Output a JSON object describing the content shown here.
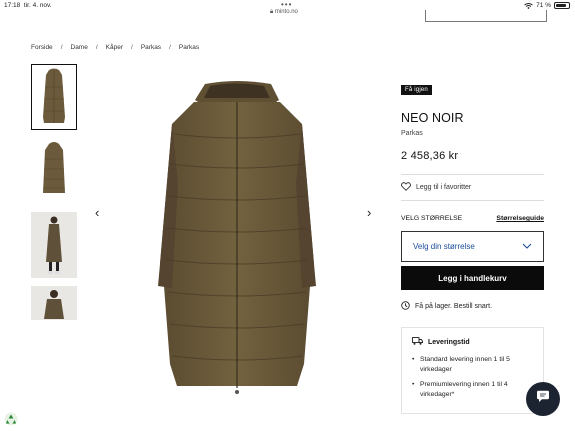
{
  "status_bar": {
    "time": "17:18",
    "date": "tir. 4. nov.",
    "url": "minto.no",
    "battery": "71 %",
    "battery_level": 0.71
  },
  "breadcrumb": [
    "Forside",
    "Dame",
    "Kåper",
    "Parkas",
    "Parkas"
  ],
  "product": {
    "badge": "Få igjen",
    "brand": "NEO NOIR",
    "category": "Parkas",
    "price": "2 458,36 kr",
    "favorite_label": "Legg til i favoritter",
    "size_label": "VELG STØRRELSE",
    "size_guide": "Størrelseguide",
    "size_select": "Velg din størrelse",
    "cart_button": "Legg i handlekurv",
    "stock_text": "Få på lager. Bestill snart."
  },
  "delivery": {
    "title": "Leveringstid",
    "items": [
      "Standard levering innen 1 til 5 virkedager",
      "Premiumlevering innen 1 til 4 virkedager*"
    ]
  },
  "colors": {
    "coat": "#6b5a3b",
    "accent_link": "#1a4c99",
    "button": "#0b0b0b"
  },
  "icons": [
    "heart-icon",
    "clock-icon",
    "truck-icon",
    "chat-icon",
    "chevron-left-icon",
    "chevron-right-icon",
    "chevron-down-icon",
    "recycle-icon"
  ]
}
